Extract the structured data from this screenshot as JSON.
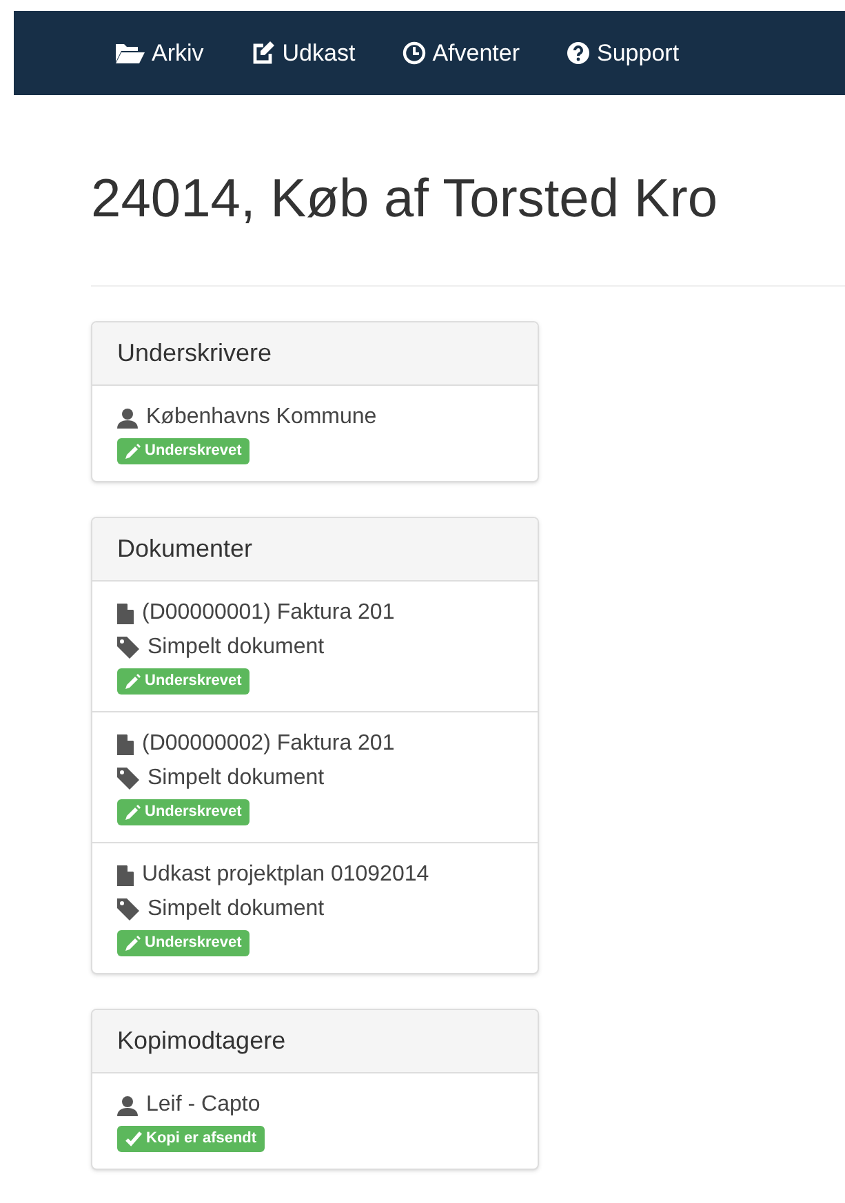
{
  "nav": [
    {
      "kind": "folder",
      "label": "Arkiv"
    },
    {
      "kind": "edit",
      "label": "Udkast"
    },
    {
      "kind": "clock",
      "label": "Afventer"
    },
    {
      "kind": "help",
      "label": "Support"
    }
  ],
  "title": "24014, Køb af Torsted Kro",
  "panels": [
    {
      "heading": "Underskrivere",
      "items": [
        {
          "kind": "person",
          "name": "Københavns Kommune",
          "badge": {
            "kind": "signed",
            "label": "Underskrevet"
          }
        }
      ]
    },
    {
      "heading": "Dokumenter",
      "items": [
        {
          "kind": "document",
          "name": "(D00000001) Faktura 201",
          "type": "Simpelt dokument",
          "badge": {
            "kind": "signed",
            "label": "Underskrevet"
          }
        },
        {
          "kind": "document",
          "name": "(D00000002) Faktura 201",
          "type": "Simpelt dokument",
          "badge": {
            "kind": "signed",
            "label": "Underskrevet"
          }
        },
        {
          "kind": "document",
          "name": "Udkast projektplan 01092014",
          "type": "Simpelt dokument",
          "badge": {
            "kind": "signed",
            "label": "Underskrevet"
          }
        }
      ]
    },
    {
      "heading": "Kopimodtagere",
      "items": [
        {
          "kind": "person",
          "name": "Leif - Capto",
          "badge": {
            "kind": "sent",
            "label": "Kopi er afsendt"
          }
        }
      ]
    }
  ]
}
